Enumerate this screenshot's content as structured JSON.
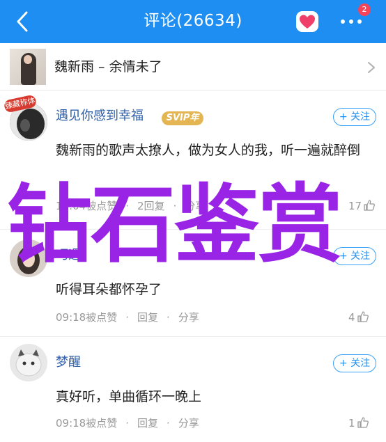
{
  "header": {
    "title": "评论(26634)",
    "badge_count": "2",
    "bg_color": "#1e8ef2"
  },
  "song": {
    "title": "魏新雨 – 余情未了"
  },
  "comments": [
    {
      "username": "遇见你感到幸福",
      "vip_badge": "SVIP年",
      "avatar_tag": "臻藏称体",
      "follow_label": "+ 关注",
      "text": "魏新雨的歌声太撩人，做为女人的我，听一遍就醉倒",
      "time": "13:04被点赞",
      "reply": "2回复",
      "share": "分享",
      "likes": "17"
    },
    {
      "username": "巧遇",
      "follow_label": "+ 关注",
      "text": "听得耳朵都怀孕了",
      "time": "09:18被点赞",
      "reply": "回复",
      "share": "分享",
      "likes": "4"
    },
    {
      "username": "梦醒",
      "follow_label": "+ 关注",
      "text": "真好听，单曲循环一晚上",
      "time": "09:18被点赞",
      "reply": "回复",
      "share": "分享",
      "likes": "1"
    }
  ],
  "overlay_text": "钻石鉴赏",
  "overlay_color": "#9a24e6"
}
